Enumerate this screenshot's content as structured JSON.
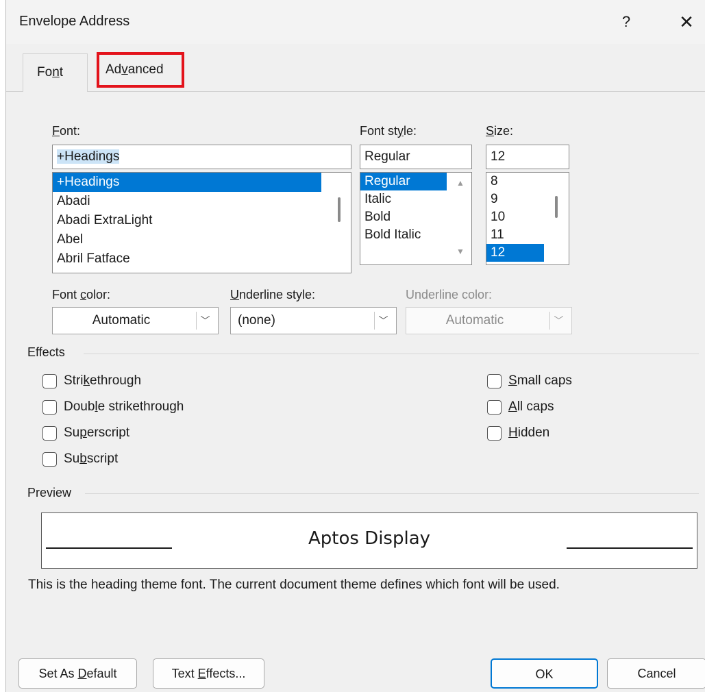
{
  "window": {
    "title": "Envelope Address",
    "help_label": "?",
    "close_label": "✕"
  },
  "tabs": {
    "font": {
      "label_pre": "Fo",
      "label_u": "n",
      "label_post": "t"
    },
    "advanced": {
      "label_pre": "Ad",
      "label_u": "v",
      "label_post": "anced"
    }
  },
  "font": {
    "label_u": "F",
    "label_post": "ont:",
    "value": "+Headings",
    "items": [
      "+Headings",
      "Abadi",
      "Abadi ExtraLight",
      "Abel",
      "Abril Fatface"
    ],
    "selected": "+Headings"
  },
  "font_style": {
    "label_pre": "Font st",
    "label_u": "y",
    "label_post": "le:",
    "value": "Regular",
    "items": [
      "Regular",
      "Italic",
      "Bold",
      "Bold Italic"
    ],
    "selected": "Regular"
  },
  "size": {
    "label_u": "S",
    "label_post": "ize:",
    "value": "12",
    "items": [
      "8",
      "9",
      "10",
      "11",
      "12"
    ],
    "selected": "12"
  },
  "font_color": {
    "label_pre": "Font ",
    "label_u": "c",
    "label_post": "olor:",
    "value": "Automatic"
  },
  "underline_style": {
    "label_u": "U",
    "label_post": "nderline style:",
    "value": "(none)"
  },
  "underline_color": {
    "label": "Underline color:",
    "value": "Automatic"
  },
  "effects": {
    "title": "Effects",
    "strikethrough": {
      "pre": "Stri",
      "u": "k",
      "post": "ethrough"
    },
    "double_strikethrough": {
      "pre": "Doub",
      "u": "l",
      "post": "e strikethrough"
    },
    "superscript": {
      "pre": "Su",
      "u": "p",
      "post": "erscript"
    },
    "subscript": {
      "pre": "Su",
      "u": "b",
      "post": "script"
    },
    "small_caps": {
      "pre": "",
      "u": "S",
      "post": "mall caps"
    },
    "all_caps": {
      "pre": "",
      "u": "A",
      "post": "ll caps"
    },
    "hidden": {
      "pre": "",
      "u": "H",
      "post": "idden"
    }
  },
  "preview": {
    "title": "Preview",
    "sample": "Aptos Display",
    "note": "This is the heading theme font. The current document theme defines which font will be used."
  },
  "buttons": {
    "set_default": {
      "pre": "Set As ",
      "u": "D",
      "post": "efault"
    },
    "text_effects": {
      "pre": "Text ",
      "u": "E",
      "post": "ffects..."
    },
    "ok": "OK",
    "cancel": "Cancel"
  },
  "colors": {
    "selection": "#0078d4",
    "highlight_box": "#e3131b"
  }
}
